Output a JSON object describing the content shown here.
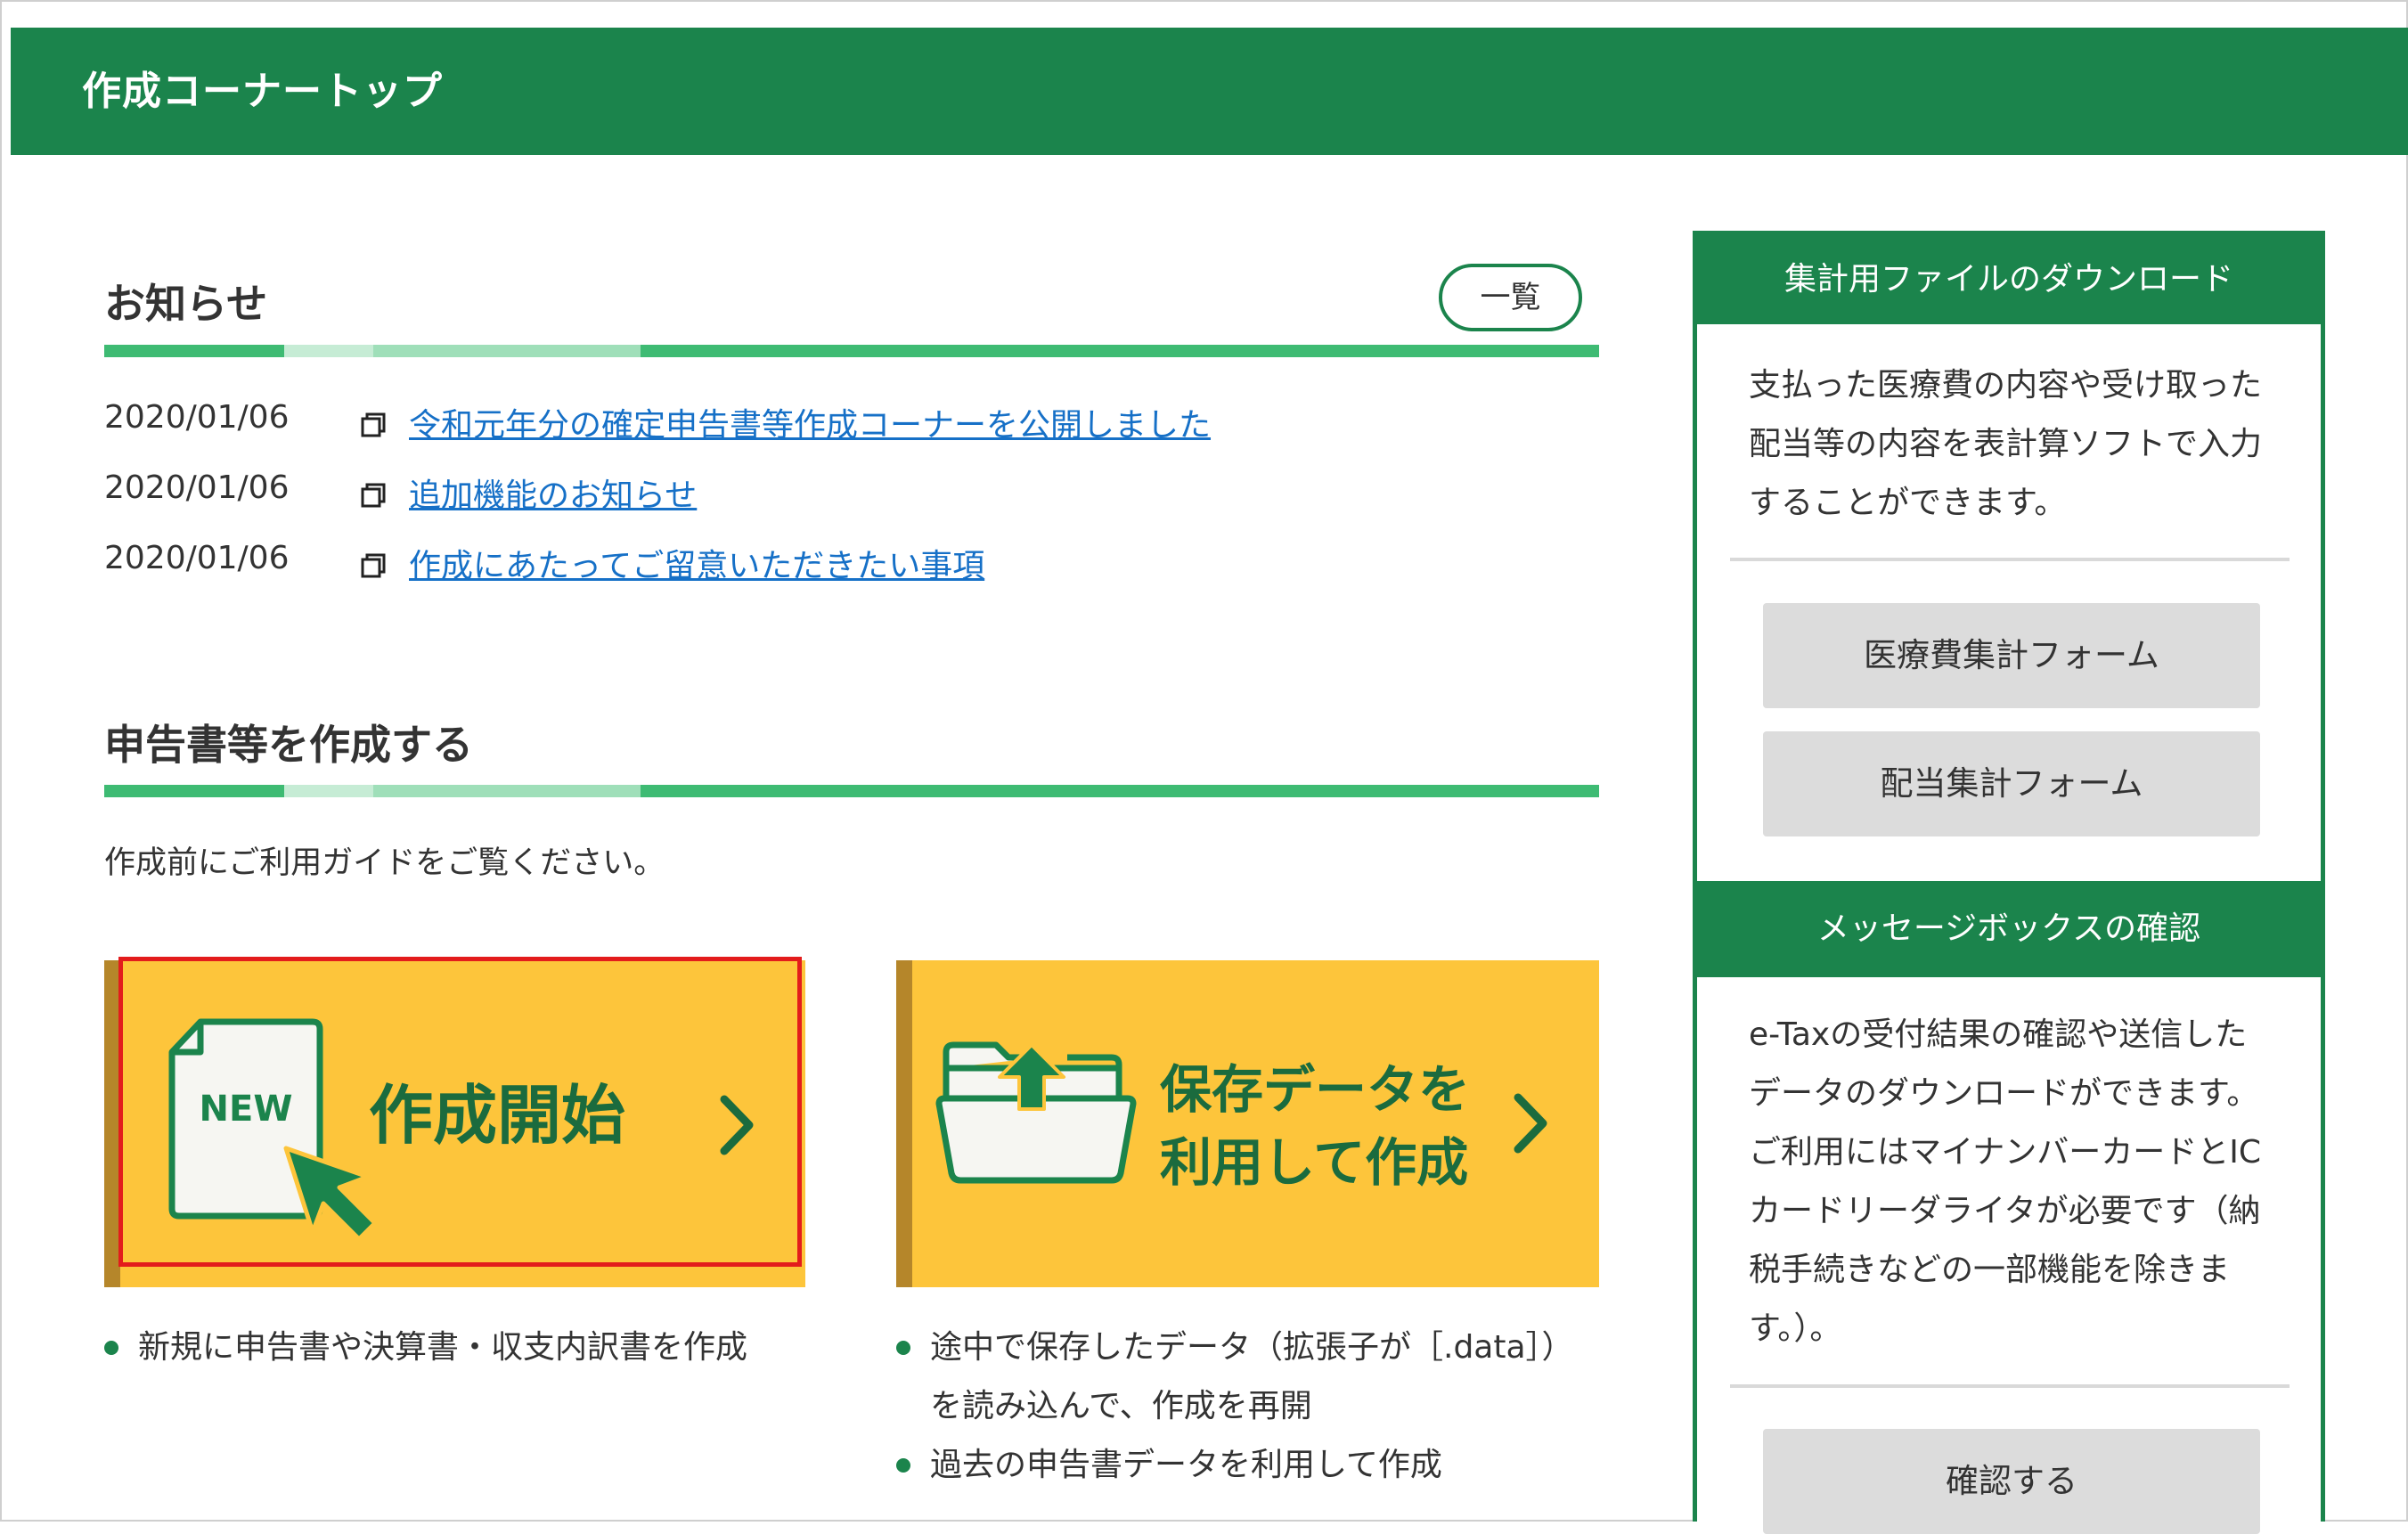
{
  "header": {
    "title": "作成コーナートップ"
  },
  "news": {
    "heading": "お知らせ",
    "list_button": "一覧",
    "items": [
      {
        "date": "2020/01/06",
        "text": "令和元年分の確定申告書等作成コーナーを公開しました"
      },
      {
        "date": "2020/01/06",
        "text": "追加機能のお知らせ"
      },
      {
        "date": "2020/01/06",
        "text": "作成にあたってご留意いただきたい事項"
      }
    ]
  },
  "create": {
    "heading": "申告書等を作成する",
    "guide": "作成前にご利用ガイドをご覧ください。",
    "new_button": {
      "label": "作成開始",
      "icon_text": "NEW"
    },
    "saved_button": {
      "line1": "保存データを",
      "line2": "利用して作成"
    },
    "new_bullets": [
      "新規に申告書や決算書・収支内訳書を作成"
    ],
    "saved_bullets": [
      {
        "line1": "途中で保存したデータ（拡張子が［.data］）",
        "line2": "を読み込んで、作成を再開"
      },
      {
        "line1": "過去の申告書データを利用して作成"
      }
    ]
  },
  "sidebar": {
    "download": {
      "title": "集計用ファイルのダウンロード",
      "desc": [
        "支払った医療費の内容や受け取った",
        "配当等の内容を表計算ソフトで入力",
        "することができます。"
      ],
      "buttons": [
        "医療費集計フォーム",
        "配当集計フォーム"
      ]
    },
    "message": {
      "title": "メッセージボックスの確認",
      "desc": [
        "e-Taxの受付結果の確認や送信した",
        "データのダウンロードができます。",
        "ご利用にはマイナンバーカードとIC",
        "カードリーダライタが必要です（納",
        "税手続きなどの一部機能を除きま",
        "す。）。"
      ],
      "button": "確認する"
    }
  },
  "colors": {
    "brand_green": "#1b844c",
    "accent_yellow": "#fdc53b",
    "link_blue": "#1670c7",
    "highlight_red": "#e31c1c"
  }
}
